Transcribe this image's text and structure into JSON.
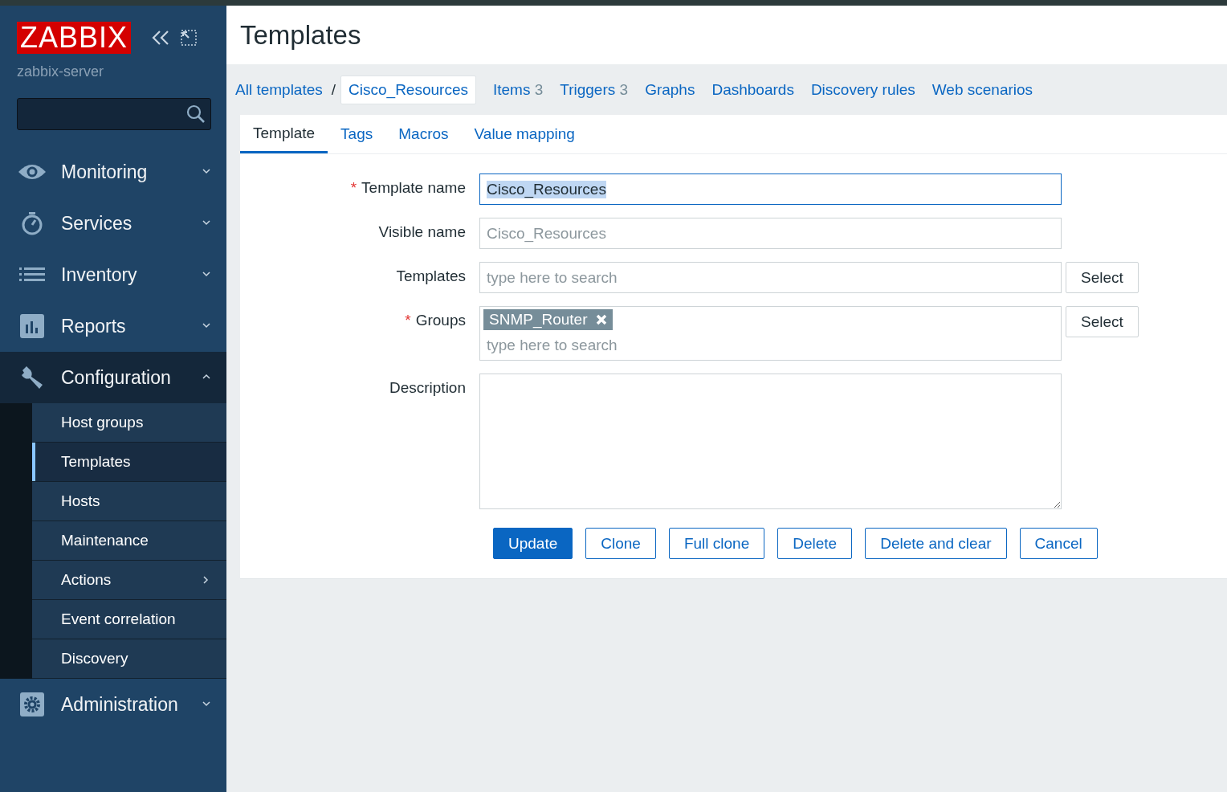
{
  "sidebar": {
    "logo": "ZABBIX",
    "server": "zabbix-server",
    "menu": [
      {
        "label": "Monitoring",
        "expanded": false
      },
      {
        "label": "Services",
        "expanded": false
      },
      {
        "label": "Inventory",
        "expanded": false
      },
      {
        "label": "Reports",
        "expanded": false
      },
      {
        "label": "Configuration",
        "expanded": true,
        "children": [
          {
            "label": "Host groups",
            "selected": false,
            "submenu": false
          },
          {
            "label": "Templates",
            "selected": true,
            "submenu": false
          },
          {
            "label": "Hosts",
            "selected": false,
            "submenu": false
          },
          {
            "label": "Maintenance",
            "selected": false,
            "submenu": false
          },
          {
            "label": "Actions",
            "selected": false,
            "submenu": true
          },
          {
            "label": "Event correlation",
            "selected": false,
            "submenu": false
          },
          {
            "label": "Discovery",
            "selected": false,
            "submenu": false
          }
        ]
      },
      {
        "label": "Administration",
        "expanded": false
      }
    ]
  },
  "page_title": "Templates",
  "breadcrumbs": [
    {
      "label": "All templates",
      "current": false
    },
    {
      "label": "/",
      "kind": "separator"
    },
    {
      "label": "Cisco_Resources",
      "current": true
    }
  ],
  "nav_links": [
    {
      "label": "Items",
      "count": "3"
    },
    {
      "label": "Triggers",
      "count": "3"
    },
    {
      "label": "Graphs"
    },
    {
      "label": "Dashboards"
    },
    {
      "label": "Discovery rules"
    },
    {
      "label": "Web scenarios"
    }
  ],
  "tabs": [
    {
      "label": "Template",
      "selected": true
    },
    {
      "label": "Tags",
      "selected": false
    },
    {
      "label": "Macros",
      "selected": false
    },
    {
      "label": "Value mapping",
      "selected": false
    }
  ],
  "fields": [
    {
      "kind": "text",
      "label": "Template name",
      "required_mark": "*",
      "value": "Cisco_Resources",
      "focused": true
    },
    {
      "kind": "text",
      "label": "Visible name",
      "placeholder": "Cisco_Resources",
      "focused": false
    },
    {
      "kind": "multiselect",
      "label": "Templates",
      "placeholder": "type here to search",
      "button": "Select"
    },
    {
      "kind": "multiselect",
      "label": "Groups",
      "required_mark": "*",
      "tags": [
        "SNMP_Router"
      ],
      "placeholder": "type here to search",
      "button": "Select"
    },
    {
      "kind": "textarea",
      "label": "Description"
    }
  ],
  "buttons": [
    {
      "label": "Update",
      "primary": true
    },
    {
      "label": "Clone",
      "primary": false
    },
    {
      "label": "Full clone",
      "primary": false
    },
    {
      "label": "Delete",
      "primary": false
    },
    {
      "label": "Delete and clear",
      "primary": false
    },
    {
      "label": "Cancel",
      "primary": false
    }
  ]
}
